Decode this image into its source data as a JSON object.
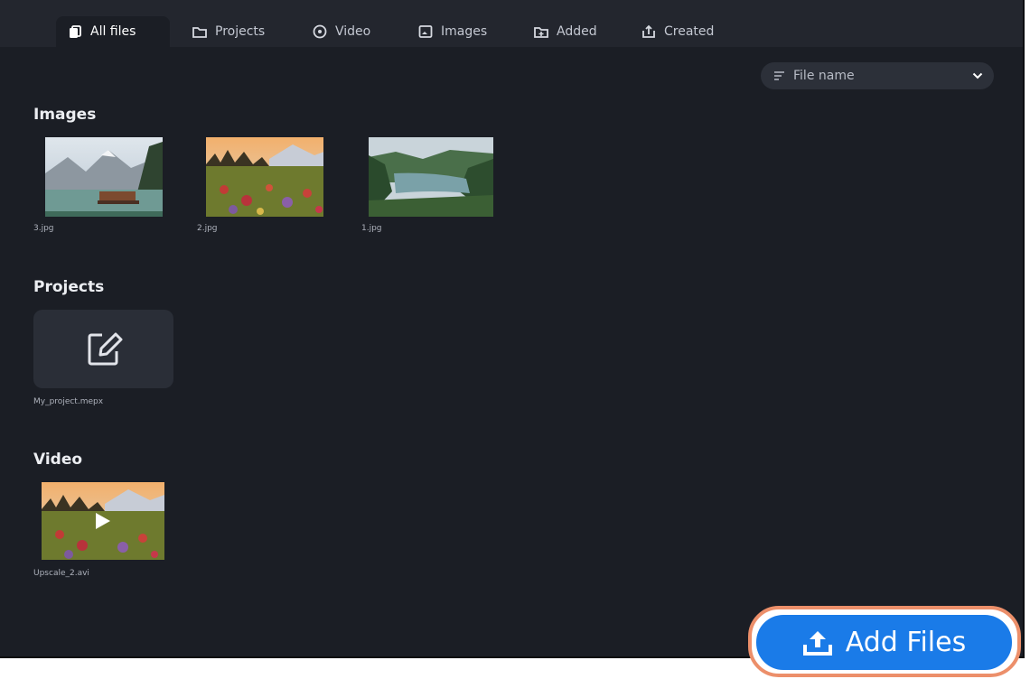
{
  "tabs": [
    {
      "label": "All files",
      "icon": "files-icon",
      "active": true
    },
    {
      "label": "Projects",
      "icon": "folder-icon"
    },
    {
      "label": "Video",
      "icon": "video-icon"
    },
    {
      "label": "Images",
      "icon": "image-icon"
    },
    {
      "label": "Added",
      "icon": "added-icon"
    },
    {
      "label": "Created",
      "icon": "created-icon"
    }
  ],
  "sort": {
    "label": "File name",
    "icon": "sort-icon"
  },
  "sections": {
    "images": {
      "title": "Images",
      "items": [
        {
          "name": "3.jpg"
        },
        {
          "name": "2.jpg"
        },
        {
          "name": "1.jpg"
        }
      ]
    },
    "projects": {
      "title": "Projects",
      "items": [
        {
          "name": "My_project.mepx"
        }
      ]
    },
    "video": {
      "title": "Video",
      "items": [
        {
          "name": "Upscale_2.avi"
        }
      ]
    }
  },
  "add_button": {
    "label": "Add Files",
    "icon": "upload-icon"
  },
  "colors": {
    "background": "#1b1e25",
    "tabbar": "#23262e",
    "accent": "#1a7be8",
    "highlight": "#ec8f6a"
  }
}
